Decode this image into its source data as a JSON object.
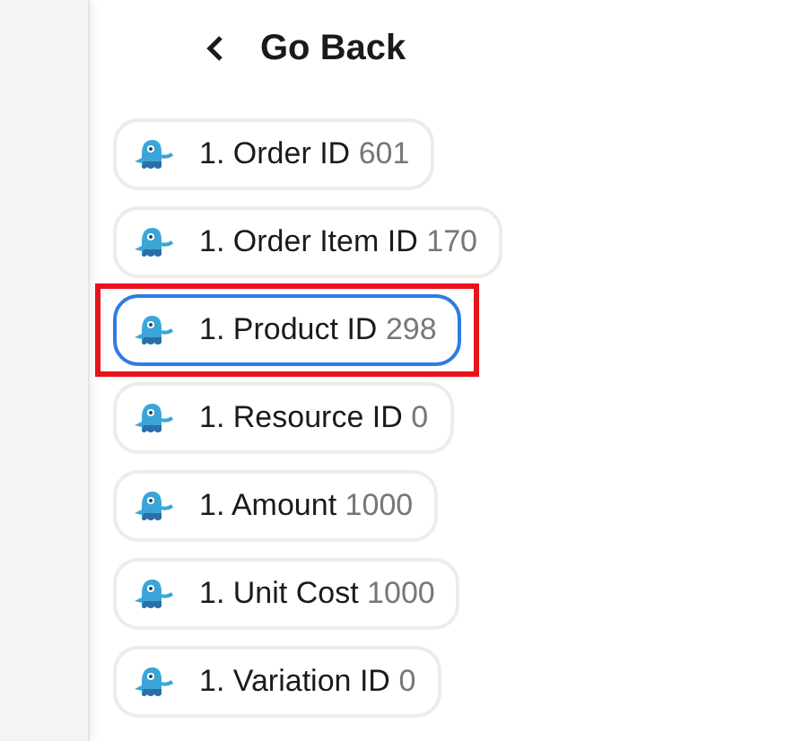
{
  "back_button": {
    "label": "Go Back"
  },
  "fields": [
    {
      "label": "1. Order ID",
      "value": "601",
      "selected": false,
      "highlighted": false
    },
    {
      "label": "1. Order Item ID",
      "value": "170",
      "selected": false,
      "highlighted": false
    },
    {
      "label": "1. Product ID",
      "value": "298",
      "selected": true,
      "highlighted": true
    },
    {
      "label": "1. Resource ID",
      "value": "0",
      "selected": false,
      "highlighted": false
    },
    {
      "label": "1. Amount",
      "value": "1000",
      "selected": false,
      "highlighted": false
    },
    {
      "label": "1. Unit Cost",
      "value": "1000",
      "selected": false,
      "highlighted": false
    },
    {
      "label": "1. Variation ID",
      "value": "0",
      "selected": false,
      "highlighted": false
    }
  ]
}
